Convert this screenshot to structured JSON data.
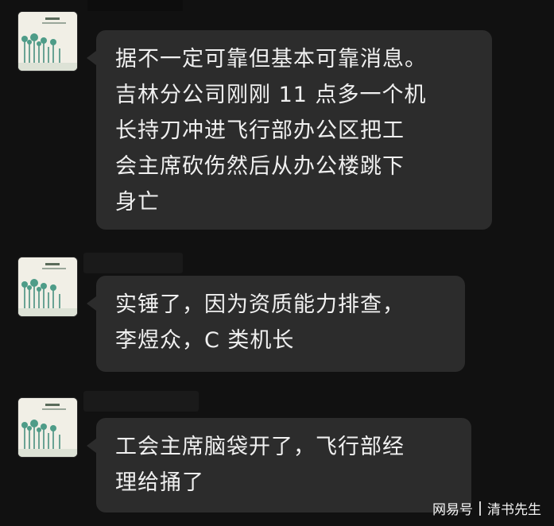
{
  "messages": [
    {
      "lines": [
        "据不一定可靠但基本可靠消息。",
        "吉林分公司刚刚 11 点多一个机",
        "长持刀冲进飞行部办公区把工",
        "会主席砍伤然后从办公楼跳下",
        "身亡"
      ]
    },
    {
      "lines": [
        "实锤了，因为资质能力排查，",
        "李煜众，C 类机长"
      ]
    },
    {
      "lines": [
        "工会主席脑袋开了，飞行部经",
        "理给捅了"
      ]
    }
  ],
  "watermark": {
    "brand": "网易号",
    "author": "清书先生"
  },
  "colors": {
    "background": "#111111",
    "bubble": "#2c2c2c",
    "text": "#f0f0f0"
  }
}
